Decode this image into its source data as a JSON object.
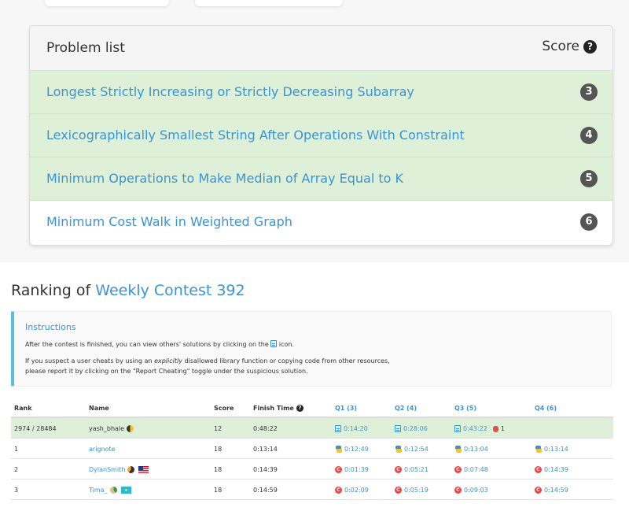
{
  "problems": {
    "header": {
      "title": "Problem list",
      "score_label": "Score",
      "help_icon": "question-circle-icon"
    },
    "items": [
      {
        "title": "Longest Strictly Increasing or Strictly Decreasing Subarray",
        "score": "3",
        "solved": true
      },
      {
        "title": "Lexicographically Smallest String After Operations With Constraint",
        "score": "4",
        "solved": true
      },
      {
        "title": "Minimum Operations to Make Median of Array Equal to K",
        "score": "5",
        "solved": true
      },
      {
        "title": "Minimum Cost Walk in Weighted Graph",
        "score": "6",
        "solved": false
      }
    ]
  },
  "ranking": {
    "title_prefix": "Ranking of",
    "contest_name": "Weekly Contest 392",
    "instructions": {
      "title": "Instructions",
      "line1_before": "After the contest is finished, you can view others' solutions by clicking on the",
      "line1_after": "icon.",
      "line2_before": "If you suspect a user cheats by using an",
      "line2_emph": "explicitly",
      "line2_after": "disallowed library function or copying code from other resources,",
      "line3": "please report it by clicking on the \"Report Cheating\" toggle under the suspicious solution."
    },
    "columns": {
      "rank": "Rank",
      "name": "Name",
      "score": "Score",
      "finish_time": "Finish Time",
      "q1": "Q1 (3)",
      "q2": "Q2 (4)",
      "q3": "Q3 (5)",
      "q4": "Q4 (6)"
    },
    "rows": [
      {
        "rank": "2974 / 28484",
        "name": "yash_bhale",
        "score": "12",
        "finish": "0:48:22",
        "q1": "0:14:20",
        "q2": "0:28:06",
        "q3": "0:43:22",
        "q3_penalty": "1",
        "q4": ""
      },
      {
        "rank": "1",
        "name": "arignote",
        "score": "18",
        "finish": "0:13:14",
        "q1": "0:12:49",
        "q2": "0:12:54",
        "q3": "0:13:04",
        "q4": "0:13:14"
      },
      {
        "rank": "2",
        "name": "DylanSmith",
        "score": "18",
        "finish": "0:14:39",
        "q1": "0:01:39",
        "q2": "0:05:21",
        "q3": "0:07:48",
        "q4": "0:14:39"
      },
      {
        "rank": "3",
        "name": "Tima_",
        "score": "18",
        "finish": "0:14:59",
        "q1": "0:02:09",
        "q2": "0:05:19",
        "q3": "0:09:03",
        "q4": "0:14:59"
      }
    ]
  },
  "colors": {
    "link": "#3a93d3",
    "solved_bg": "#dff0d8",
    "badge": "#555555",
    "info_border": "#5bc0de"
  }
}
